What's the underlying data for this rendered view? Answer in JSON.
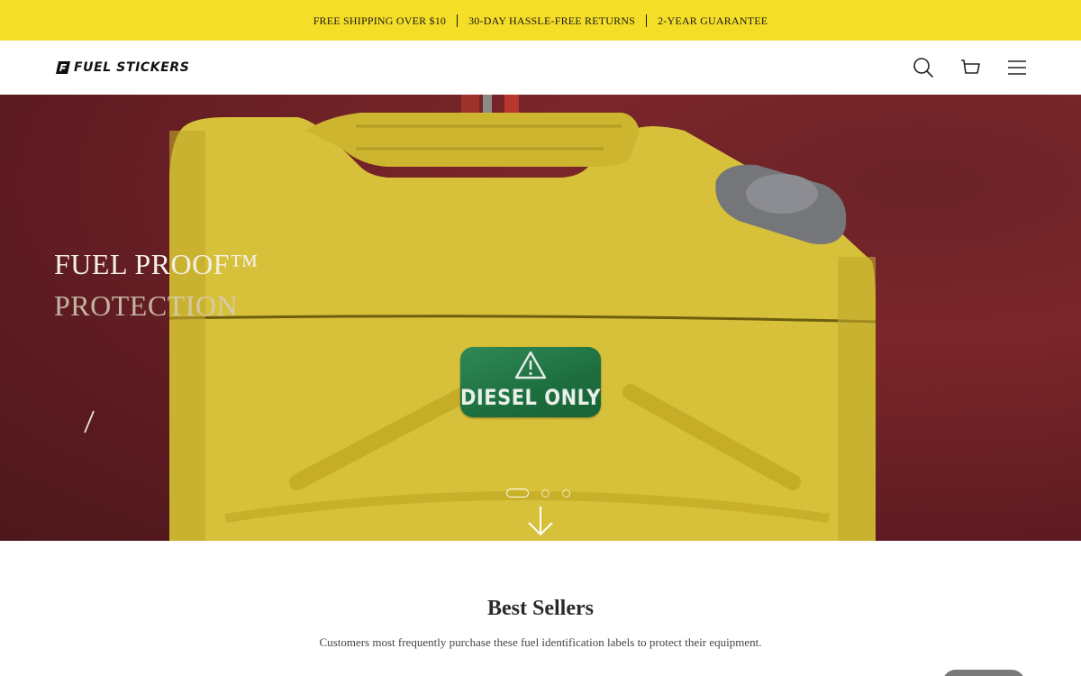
{
  "announcement": {
    "items": [
      "FREE SHIPPING OVER $10",
      "30-DAY HASSLE-FREE RETURNS",
      "2-YEAR GUARANTEE"
    ]
  },
  "header": {
    "logo_text": "FUEL STICKERS",
    "icons": [
      "search-icon",
      "cart-icon",
      "menu-icon"
    ]
  },
  "hero": {
    "title_line1": "FUEL PROOF™",
    "title_line2": "PROTECTION",
    "label_text": "DIESEL ONLY",
    "slides_total": 3,
    "active_slide": 1
  },
  "best_sellers": {
    "title": "Best Sellers",
    "subtitle": "Customers most frequently purchase these fuel identification labels to protect their equipment."
  },
  "colors": {
    "announcement_bg": "#f5de27",
    "hero_bg": "#7b262a",
    "can_yellow": "#d9c23c",
    "label_green": "#1d6e3f"
  }
}
